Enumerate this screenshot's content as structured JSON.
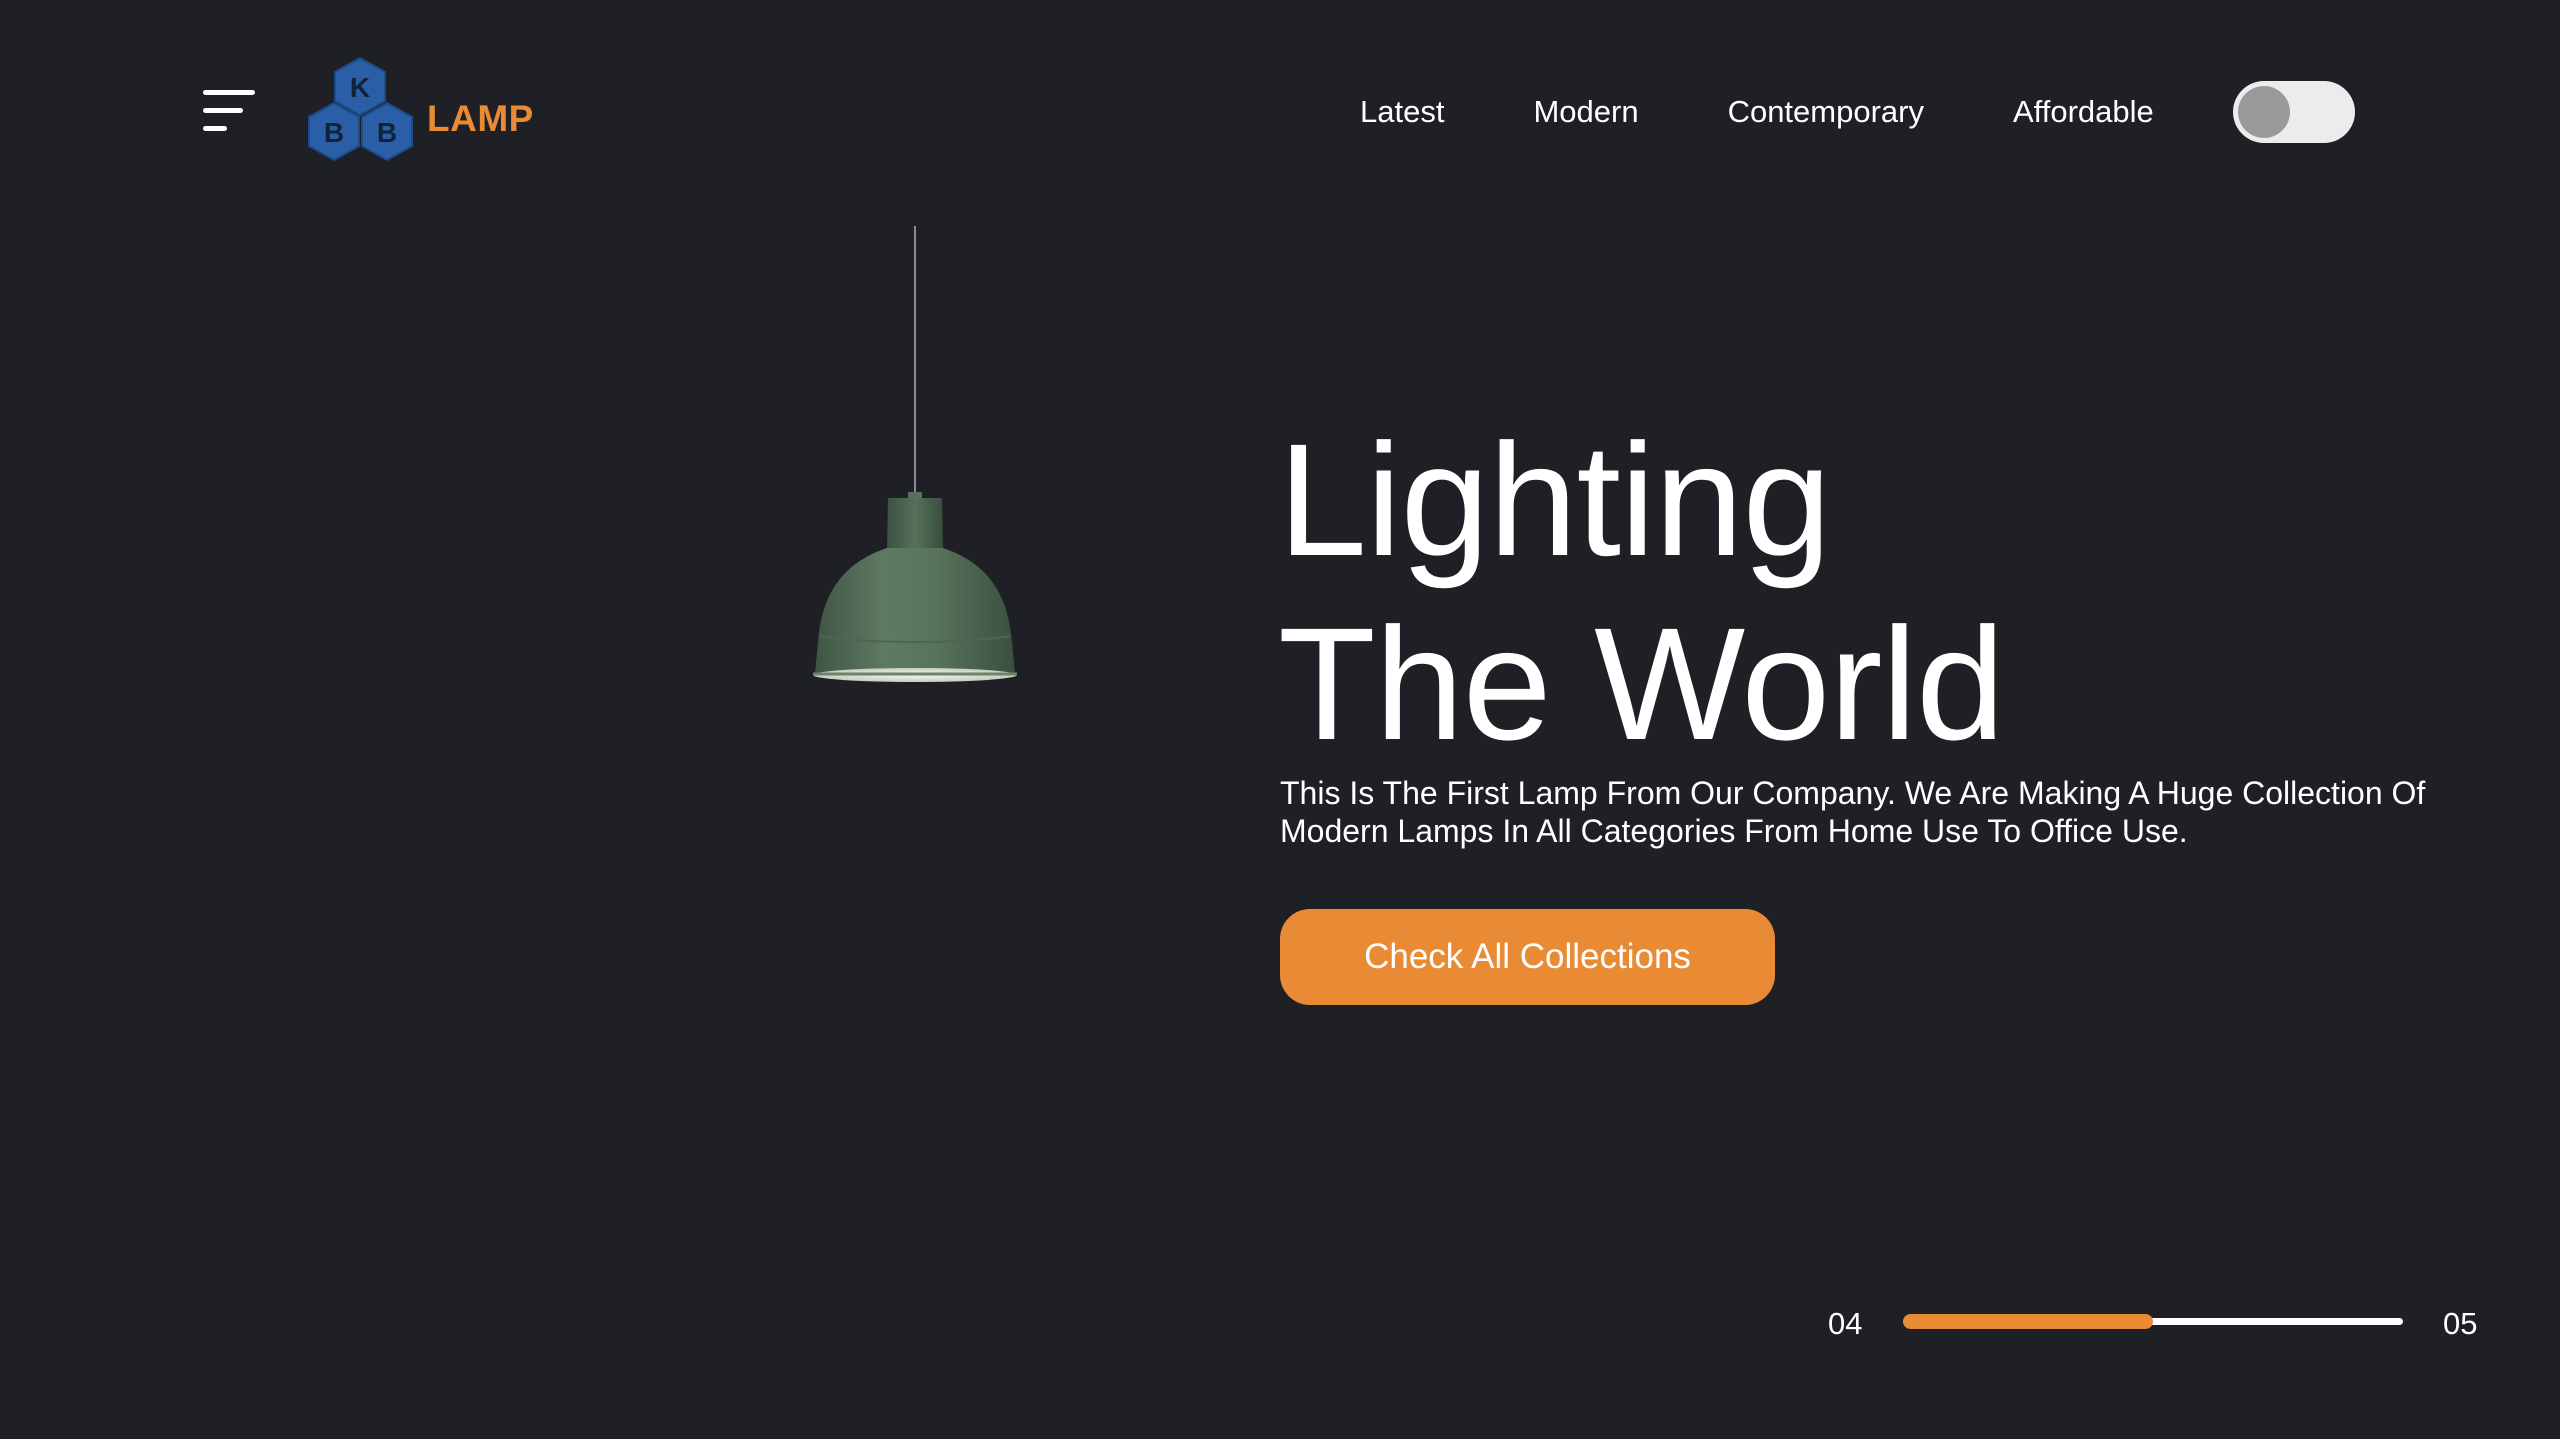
{
  "header": {
    "menu_icon": "hamburger-menu-icon",
    "logo": {
      "mark_letters": [
        "K",
        "B",
        "B"
      ],
      "word": "LAMP"
    },
    "nav": [
      {
        "label": "Latest"
      },
      {
        "label": "Modern"
      },
      {
        "label": "Contemporary"
      },
      {
        "label": "Affordable"
      }
    ],
    "theme_toggle": {
      "state": "off"
    }
  },
  "hero": {
    "title_line1": "Lighting",
    "title_line2": "The World",
    "description": "This Is The First Lamp From Our Company. We Are Making A Huge Collection Of Modern Lamps In All Categories From Home Use To Office Use.",
    "cta_label": "Check All Collections"
  },
  "slider": {
    "current": "04",
    "total": "05",
    "progress": 0.5
  },
  "colors": {
    "background": "#1f2026",
    "accent": "#e98b34",
    "logo_blue": "#2a5ea6",
    "lamp_green": "#58735c",
    "text": "#ffffff"
  }
}
